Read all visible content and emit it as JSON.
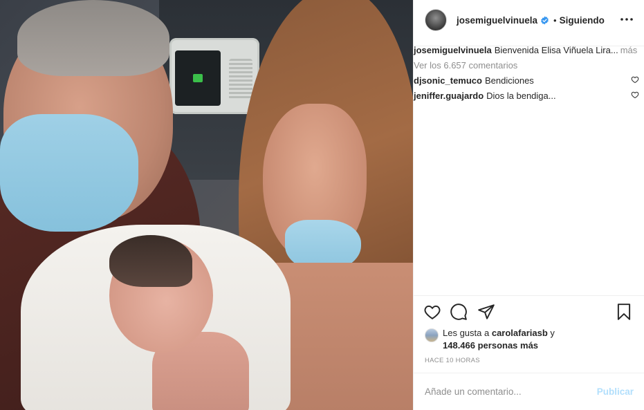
{
  "post": {
    "photo_alt": "Foto de publicación"
  },
  "header": {
    "username": "josemiguelvinuela",
    "separator": "•",
    "follow_status": "Siguiendo"
  },
  "caption": {
    "username": "josemiguelvinuela",
    "text": "Bienvenida Elisa Viñuela Lira...",
    "more": "más"
  },
  "comments": {
    "view_all": "Ver los 6.657 comentarios",
    "items": [
      {
        "username": "djsonic_temuco",
        "text": "Bendiciones"
      },
      {
        "username": "jeniffer.guajardo",
        "text": "Dios la bendiga..."
      }
    ]
  },
  "likes": {
    "prefix": "Les gusta a",
    "liker": "carolafariasb",
    "conjunction": "y",
    "others": "148.466 personas más"
  },
  "timestamp": "HACE 10 HORAS",
  "add_comment": {
    "placeholder": "Añade un comentario...",
    "publish": "Publicar"
  },
  "colors": {
    "verified": "#3897f0",
    "publish_disabled": "#b2dffc",
    "muted": "#8e8e8e",
    "text": "#262626"
  },
  "icons": {
    "like": "heart-icon",
    "comment": "comment-icon",
    "share": "send-icon",
    "save": "bookmark-icon",
    "more": "more-options-icon",
    "verified": "verified-badge-icon"
  }
}
